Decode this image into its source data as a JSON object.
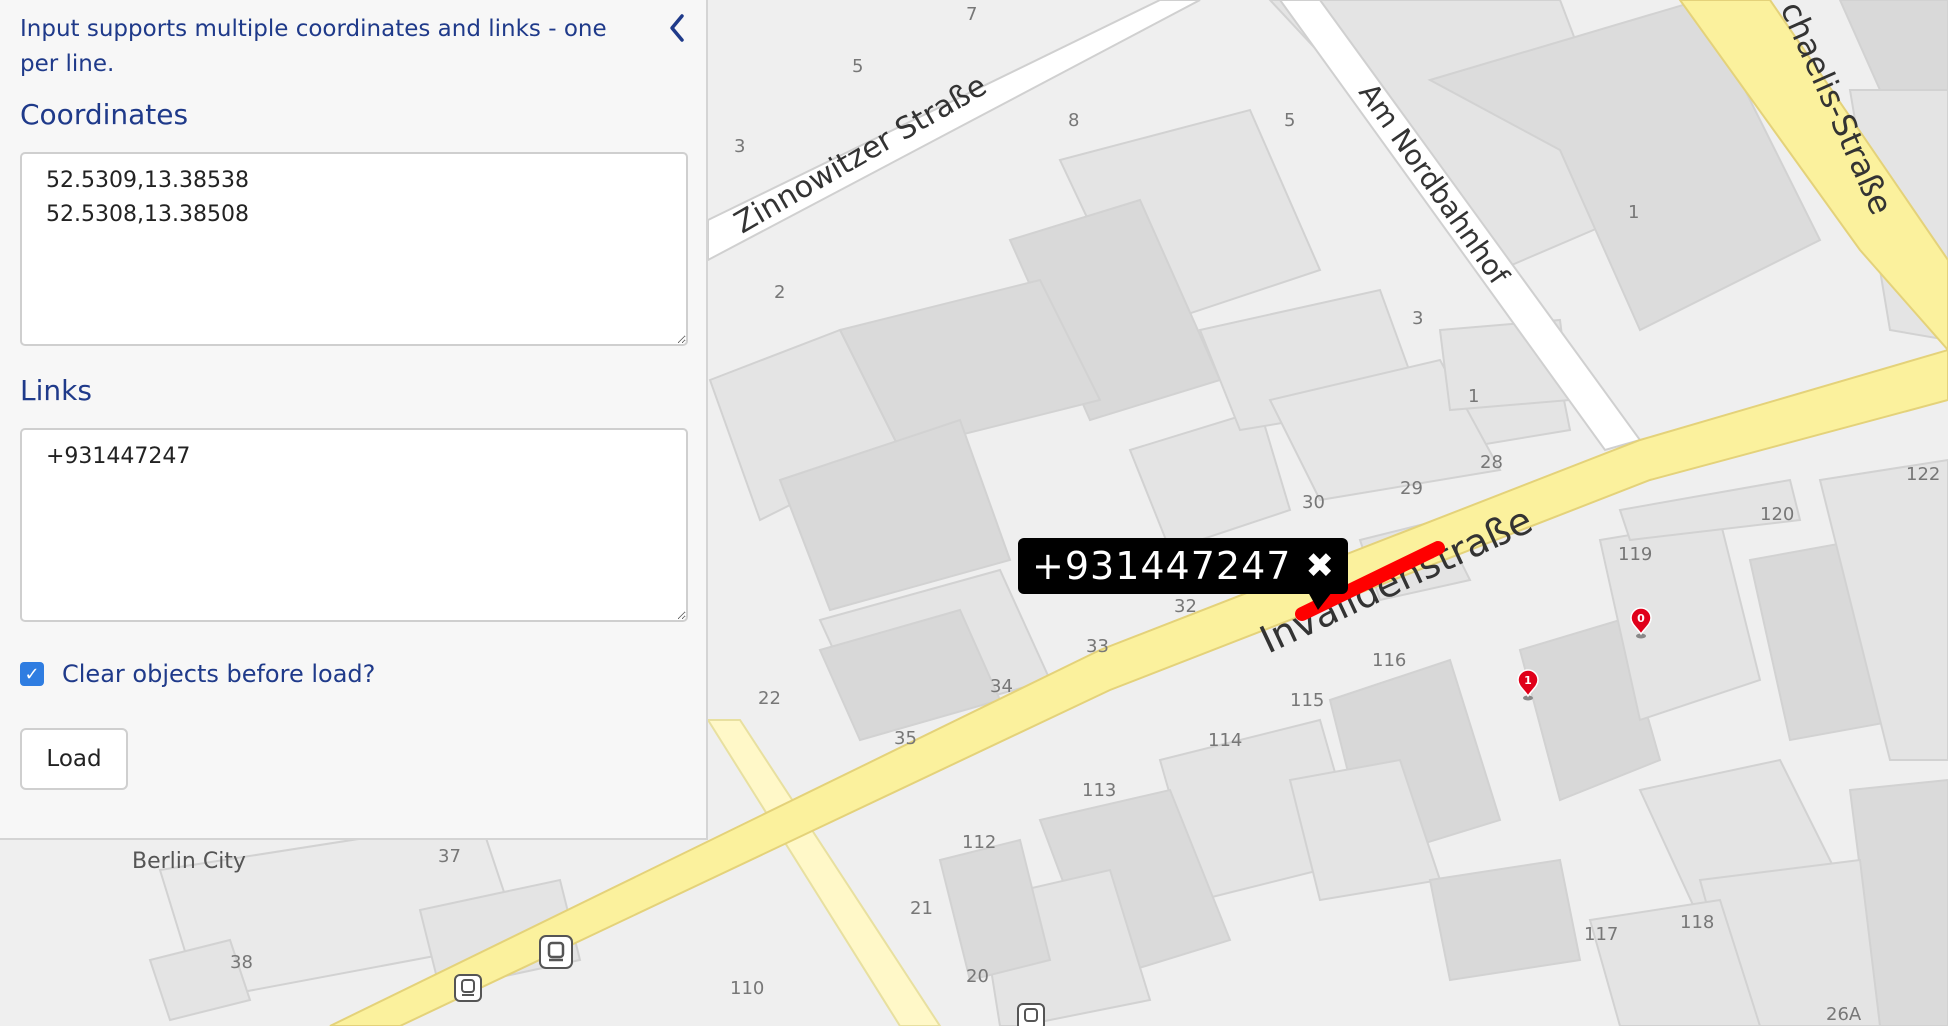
{
  "panel": {
    "intro": "Input supports multiple coordinates and links - one per line.",
    "collapse_icon": "chevron-left-icon",
    "coordinates_title": "Coordinates",
    "coordinates_value": "52.5309,13.38538\n52.5308,13.38508",
    "links_title": "Links",
    "links_value": "+931447247",
    "clear_label": "Clear objects before load?",
    "clear_checked": true,
    "load_label": "Load"
  },
  "popup": {
    "text": "+931447247",
    "close_icon": "close-icon",
    "close_glyph": "✖"
  },
  "map": {
    "streets": {
      "zinnowitzer": "Zinnowitzer Straße",
      "nordbahnhof": "Am Nordbahnhof",
      "michaelis": "chaelis-Straße",
      "invaliden": "Invalidenstraße"
    },
    "area_label": "Berlin City",
    "house_numbers": [
      "7",
      "5",
      "3",
      "8",
      "5",
      "2",
      "1",
      "3",
      "1",
      "28",
      "29",
      "30",
      "122",
      "120",
      "119",
      "32",
      "33",
      "34",
      "22",
      "116",
      "115",
      "114",
      "113",
      "35",
      "112",
      "37",
      "21",
      "38",
      "20",
      "110",
      "117",
      "118",
      "26A"
    ],
    "markers": [
      {
        "label": "0",
        "color": "#e0001a"
      },
      {
        "label": "1",
        "color": "#e0001a"
      }
    ],
    "colors": {
      "background": "#efefef",
      "building": "#e3e3e3",
      "building_dark": "#d9d9d9",
      "main_road": "#fbf19d",
      "road_casing": "#e4d27a",
      "minor_road": "#ffffff",
      "route": "#ff0000",
      "panel_text": "#1f3a8a"
    }
  }
}
